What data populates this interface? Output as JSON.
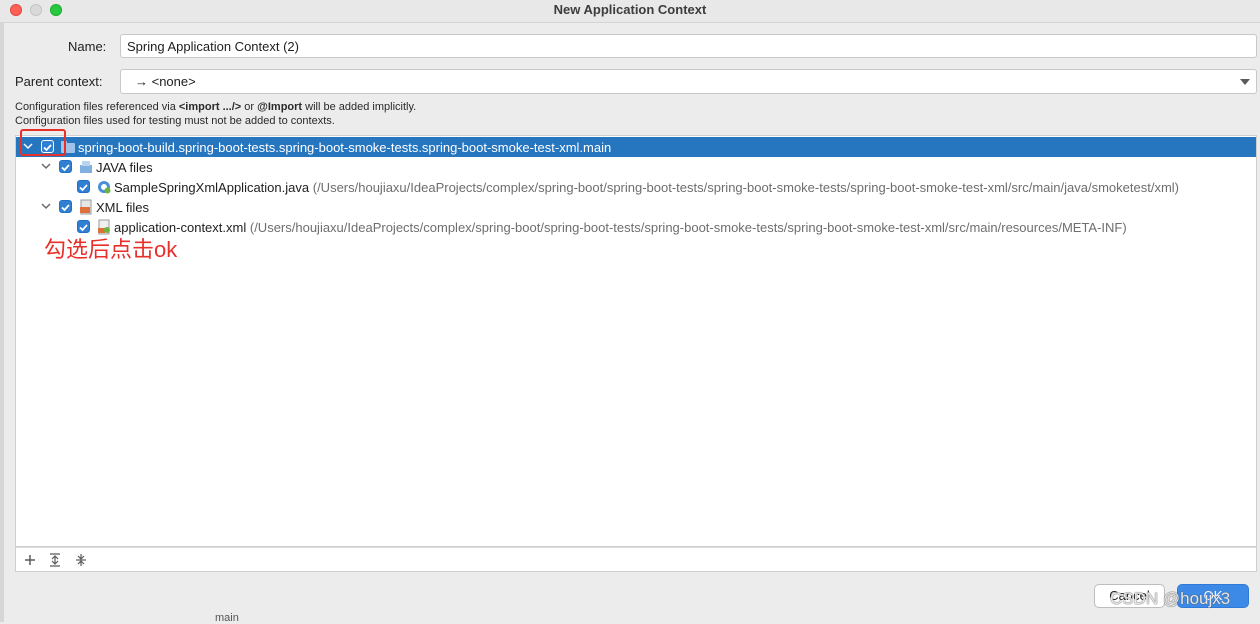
{
  "window": {
    "title": "New Application Context"
  },
  "form": {
    "name_label": "Name:",
    "name_value": "Spring Application Context (2)",
    "parent_label": "Parent context:",
    "parent_value": "→ <none>"
  },
  "info": {
    "line1_prefix": "Configuration files referenced via ",
    "line1_import_tag": "<import .../>",
    "line1_or": " or ",
    "line1_import_ann": "@Import",
    "line1_suffix": " will be added implicitly.",
    "line2": "Configuration files used for testing must not be added to contexts."
  },
  "tree": {
    "module": "spring-boot-build.spring-boot-tests.spring-boot-smoke-tests.spring-boot-smoke-test-xml.main",
    "java_group": "JAVA files",
    "java_file": "SampleSpringXmlApplication.java",
    "java_path": "(/Users/houjiaxu/IdeaProjects/complex/spring-boot/spring-boot-tests/spring-boot-smoke-tests/spring-boot-smoke-test-xml/src/main/java/smoketest/xml)",
    "xml_group": "XML files",
    "xml_file": "application-context.xml",
    "xml_path": "(/Users/houjiaxu/IdeaProjects/complex/spring-boot/spring-boot-tests/spring-boot-smoke-tests/spring-boot-smoke-test-xml/src/main/resources/META-INF)"
  },
  "annotation": {
    "text": "勾选后点击ok",
    "color": "#e8302a"
  },
  "buttons": {
    "cancel": "Cancel",
    "ok": "OK"
  },
  "watermark": "CSDN @houjx3",
  "background_fragment": "main",
  "colors": {
    "selection": "#2675bf",
    "accent": "#3d8ae6",
    "checkbox": "#2f7fd3"
  },
  "icons": {
    "toolbar": [
      "add-icon",
      "expand-all-icon",
      "collapse-all-icon"
    ],
    "tree": [
      "chevron-down-icon",
      "checkbox-icon",
      "module-folder-icon",
      "java-files-icon",
      "spring-class-icon",
      "xml-files-icon",
      "xml-file-icon"
    ]
  }
}
